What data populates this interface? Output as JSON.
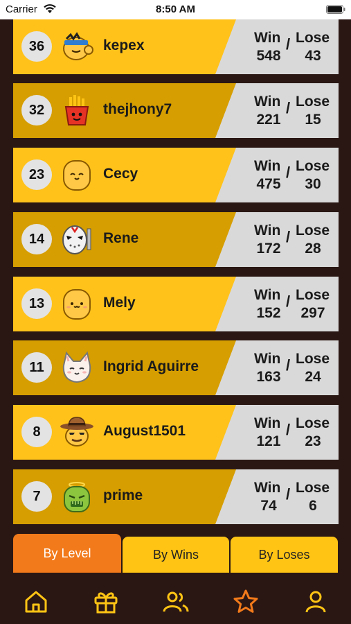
{
  "status_bar": {
    "carrier": "Carrier",
    "time": "8:50 AM"
  },
  "colors": {
    "row_light": "#ffc21b",
    "row_dark": "#d69e00",
    "stats_bg": "#d9d9d9",
    "active_tab": "#f27a1a",
    "tab": "#ffc414",
    "nav_icon": "#ffc414",
    "nav_active": "#f27a1a",
    "background": "#2a1714"
  },
  "stats_labels": {
    "win": "Win",
    "lose": "Lose",
    "separator": "/"
  },
  "players": [
    {
      "rank": "36",
      "name": "kepex",
      "avatar": "headband-avatar-icon",
      "wins": "548",
      "loses": "43"
    },
    {
      "rank": "32",
      "name": "thejhony7",
      "avatar": "fries-avatar-icon",
      "wins": "221",
      "loses": "15"
    },
    {
      "rank": "23",
      "name": "Cecy",
      "avatar": "smile-blob-avatar-icon",
      "wins": "475",
      "loses": "30"
    },
    {
      "rank": "14",
      "name": "Rene",
      "avatar": "hockey-mask-avatar-icon",
      "wins": "172",
      "loses": "28"
    },
    {
      "rank": "13",
      "name": "Mely",
      "avatar": "cute-blob-avatar-icon",
      "wins": "152",
      "loses": "297"
    },
    {
      "rank": "11",
      "name": "Ingrid Aguirre",
      "avatar": "cat-avatar-icon",
      "wins": "163",
      "loses": "24"
    },
    {
      "rank": "8",
      "name": "August1501",
      "avatar": "cowboy-avatar-icon",
      "wins": "121",
      "loses": "23"
    },
    {
      "rank": "7",
      "name": "prime",
      "avatar": "zombie-avatar-icon",
      "wins": "74",
      "loses": "6"
    }
  ],
  "tabs": {
    "by_level": "By Level",
    "by_wins": "By Wins",
    "by_loses": "By Loses",
    "active": "by_level"
  },
  "bottom_nav": [
    {
      "icon": "home-icon"
    },
    {
      "icon": "gift-icon"
    },
    {
      "icon": "friends-icon"
    },
    {
      "icon": "star-icon",
      "active": true
    },
    {
      "icon": "profile-icon"
    }
  ]
}
